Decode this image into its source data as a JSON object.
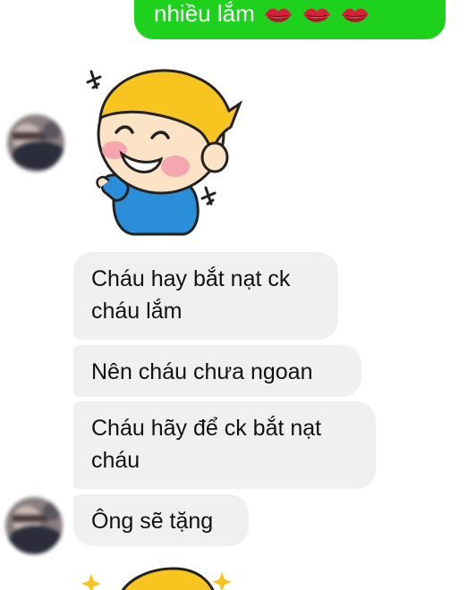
{
  "messages": {
    "outgoing": {
      "text": "nhiều lắm",
      "emoji_icons": [
        "kiss-mark-icon",
        "kiss-mark-icon",
        "kiss-mark-icon"
      ],
      "color": "#1dd11d"
    },
    "incoming": [
      {
        "text": "Cháu hay bắt nạt ck\ncháu lắm"
      },
      {
        "text": "Nên cháu chưa ngoan"
      },
      {
        "text": "Cháu hãy để ck bắt nạt\ncháu"
      },
      {
        "text": "Ông sẽ tặng"
      }
    ],
    "incoming_bubble_color": "#f0f0f0"
  },
  "stickers": [
    {
      "icon": "laughing-boy-sticker-icon"
    },
    {
      "icon": "sparkle-sticker-icon"
    }
  ]
}
